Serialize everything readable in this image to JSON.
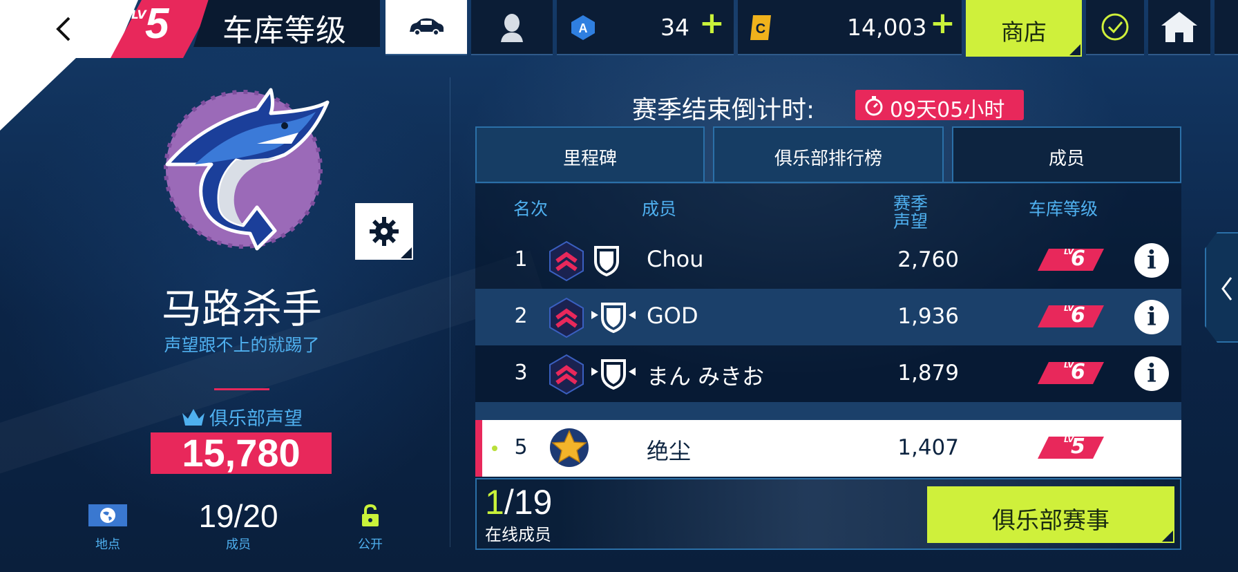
{
  "topbar": {
    "level_prefix": "LV",
    "level": "5",
    "title": "车库等级",
    "blue_currency": "34",
    "gold_currency": "14,003",
    "plus": "+",
    "shop_label": "商店"
  },
  "club": {
    "name": "马路杀手",
    "motto": "声望跟不上的就踢了",
    "reputation_label": "俱乐部声望",
    "reputation_value": "15,780",
    "location_label": "地点",
    "members_value": "19/20",
    "members_label": "成员",
    "privacy_label": "公开"
  },
  "season": {
    "countdown_label": "赛季结束倒计时:",
    "countdown_value": "09天05小时"
  },
  "tabs": [
    {
      "label": "里程碑"
    },
    {
      "label": "俱乐部排行榜"
    },
    {
      "label": "成员"
    }
  ],
  "table": {
    "headers": {
      "rank": "名次",
      "member": "成员",
      "season_rep": "赛季\n声望",
      "garage_level": "车库等级"
    },
    "rows": [
      {
        "rank": "1",
        "name": "Chou",
        "rep": "2,760",
        "level": "6"
      },
      {
        "rank": "2",
        "name": "GOD",
        "rep": "1,936",
        "level": "6"
      },
      {
        "rank": "3",
        "name": "まん みきお",
        "rep": "1,879",
        "level": "6"
      }
    ],
    "me": {
      "rank": "5",
      "name": "绝尘",
      "rep": "1,407",
      "level": "5"
    }
  },
  "bottom": {
    "online_now": "1",
    "online_total": "/19",
    "online_label": "在线成员",
    "event_button": "俱乐部赛事"
  },
  "colors": {
    "accent_red": "#e8285b",
    "accent_lime": "#cff03b",
    "label_blue": "#4fb0ef",
    "panel_navy": "#0d2440"
  }
}
